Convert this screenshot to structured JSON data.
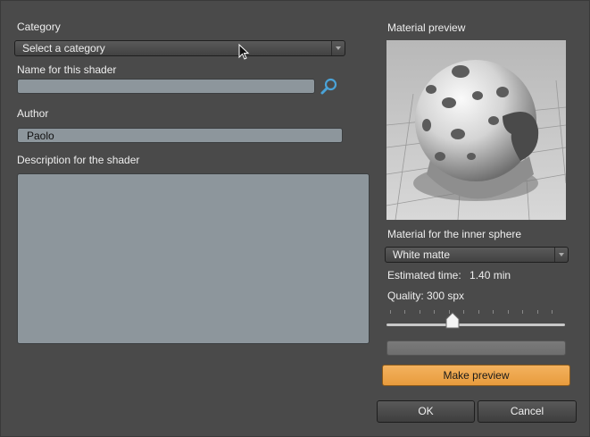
{
  "form": {
    "category_label": "Category",
    "category_value": "Select a category",
    "name_label": "Name for this shader",
    "name_value": "",
    "author_label": "Author",
    "author_value": "Paolo",
    "description_label": "Description for the shader",
    "description_value": ""
  },
  "preview": {
    "title": "Material preview",
    "image_icon": "shaded-sphere-render",
    "inner_sphere_label": "Material for the inner sphere",
    "inner_sphere_value": "White matte",
    "estimated_time_label": "Estimated time:",
    "estimated_time_value": "1.40 min",
    "quality_label": "Quality: 300 spx",
    "quality_level": 0.37,
    "make_preview_label": "Make preview",
    "progress_fraction": 0
  },
  "footer": {
    "ok_label": "OK",
    "cancel_label": "Cancel"
  },
  "colors": {
    "window_bg": "#4a4a4a",
    "field_bg": "#8d969c",
    "accent_orange": "#f0a94c",
    "search_icon": "#4aa3d8"
  },
  "icons": {
    "search": "magnifier-icon",
    "dropdown": "chevron-down-icon",
    "cursor": "mouse-pointer-icon"
  }
}
